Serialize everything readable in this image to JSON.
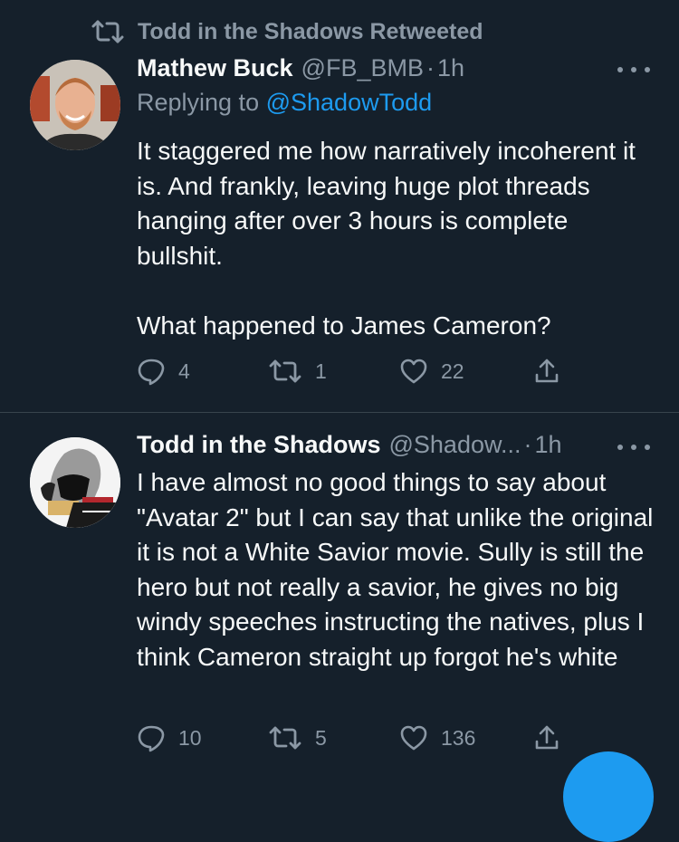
{
  "colors": {
    "background": "#15202b",
    "text": "#f7f9f9",
    "muted": "#8b98a5",
    "accent": "#1d9bf0",
    "divider": "#38444d"
  },
  "retweet_context": {
    "text": "Todd in the Shadows Retweeted",
    "icon": "retweet-icon"
  },
  "tweets": [
    {
      "author": {
        "name": "Mathew Buck",
        "handle": "@FB_BMB"
      },
      "dot": "·",
      "time": "1h",
      "reply_prefix": "Replying to",
      "reply_to": "@ShadowTodd",
      "text": "It staggered me how narratively incoherent it is. And frankly, leaving huge plot threads hanging after over 3 hours is complete bullshit.\n\nWhat happened to James Cameron?",
      "stats": {
        "replies": "4",
        "retweets": "1",
        "likes": "22"
      }
    },
    {
      "author": {
        "name": "Todd in the Shadows",
        "handle": "@Shadow..."
      },
      "dot": "·",
      "time": "1h",
      "text": "I have almost no good things to say about \"Avatar 2\" but I can say that unlike the original it is not a White Savior movie. Sully is still the hero but not really a savior, he gives no big windy speeches instructing the natives, plus I think Cameron straight up forgot he's white",
      "stats": {
        "replies": "10",
        "retweets": "5",
        "likes": "136"
      }
    }
  ],
  "icons": [
    "retweet-icon",
    "more-icon",
    "reply-icon",
    "like-icon",
    "share-icon",
    "compose-fab"
  ]
}
